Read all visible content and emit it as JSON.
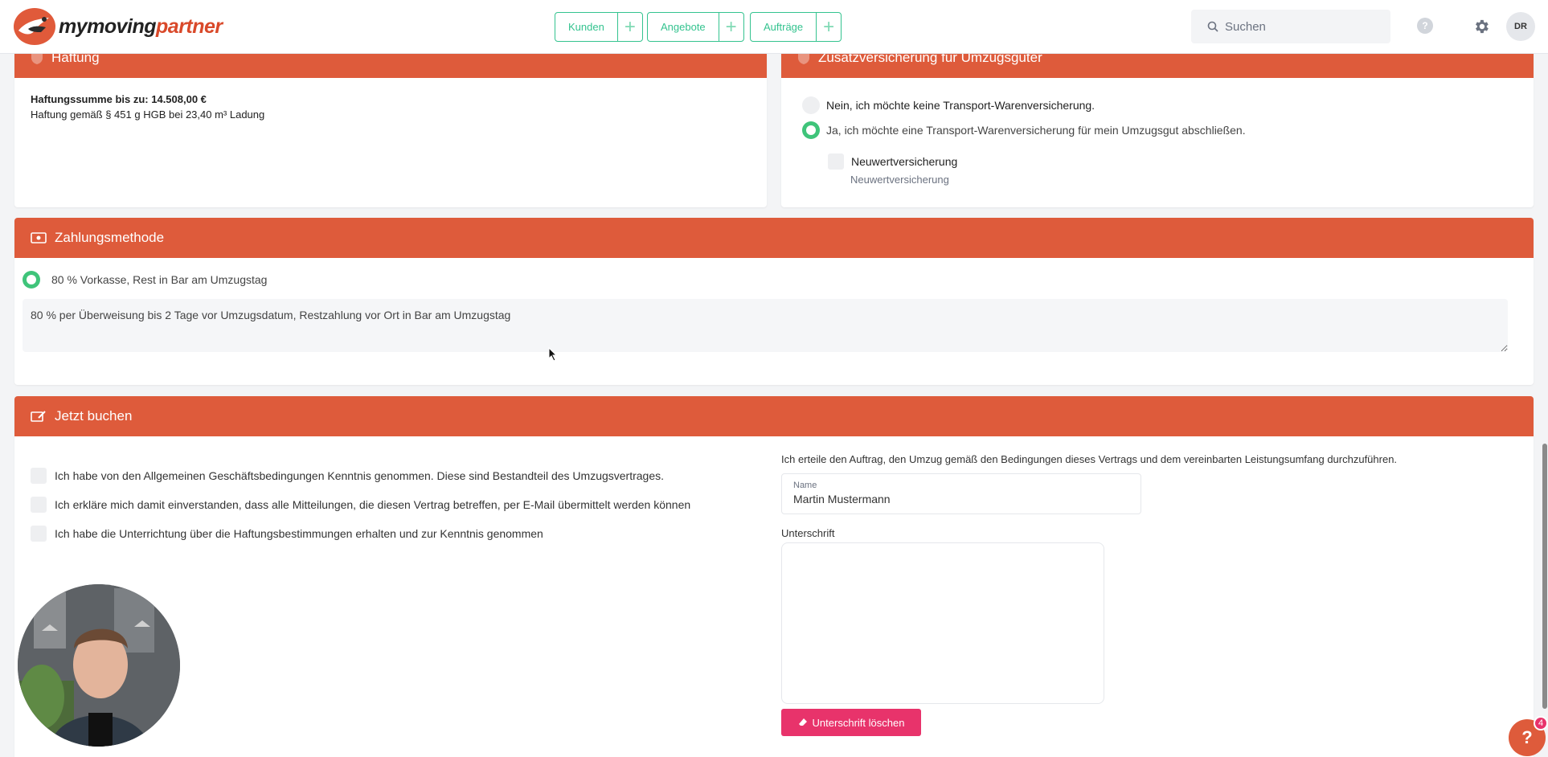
{
  "header": {
    "logo_part1": "mymoving",
    "logo_part2": "partner",
    "nav": [
      {
        "label": "Kunden",
        "plus": "+"
      },
      {
        "label": "Angebote",
        "plus": "+"
      },
      {
        "label": "Aufträge",
        "plus": "+"
      }
    ],
    "search_placeholder": "Suchen",
    "help_label": "?",
    "avatar_initials": "DR"
  },
  "haftung": {
    "title": "Haftung",
    "sum_line": "Haftungssumme bis zu: 14.508,00 €",
    "detail_line": "Haftung gemäß § 451 g HGB bei 23,40 m³ Ladung"
  },
  "versicherung": {
    "title": "Zusatzversicherung für Umzugsgüter",
    "option_no": "Nein, ich möchte keine Transport-Warenversicherung.",
    "option_yes": "Ja, ich möchte eine Transport-Warenversicherung für mein Umzugsgut abschließen.",
    "selected": "yes",
    "neuwert_label": "Neuwertversicherung",
    "neuwert_sub": "Neuwertversicherung"
  },
  "zahlung": {
    "title": "Zahlungsmethode",
    "option_label": "80 % Vorkasse, Rest in Bar am Umzugstag",
    "description": "80 % per Überweisung bis 2 Tage vor Umzugsdatum, Restzahlung vor Ort in Bar am Umzugstag"
  },
  "buchen": {
    "title": "Jetzt buchen",
    "checks": [
      "Ich habe von den Allgemeinen Geschäftsbedingungen Kenntnis genommen. Diese sind Bestandteil des Umzugsvertrages.",
      "Ich erkläre mich damit einverstanden, dass alle Mitteilungen, die diesen Vertrag betreffen, per E-Mail übermittelt werden können",
      "Ich habe die Unterrichtung über die Haftungsbestimmungen erhalten und zur Kenntnis genommen"
    ],
    "auftrag_text": "Ich erteile den Auftrag, den Umzug gemäß den Bedingungen dieses Vertrags und dem vereinbarten Leistungsumfang durchzuführen.",
    "name_caption": "Name",
    "name_value": "Martin Mustermann",
    "signature_label": "Unterschrift",
    "clear_signature": "Unterschrift löschen"
  },
  "support": {
    "help_label": "?",
    "badge_count": "4"
  },
  "colors": {
    "accent": "#de5b3b",
    "green": "#34c38f",
    "pink": "#e8336b"
  }
}
